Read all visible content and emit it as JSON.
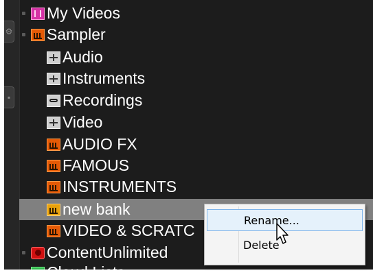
{
  "tree": {
    "items": [
      {
        "label": "My Videos",
        "icon": "video-folder-icon",
        "level": 0
      },
      {
        "label": "Sampler",
        "icon": "sampler-folder-icon",
        "level": 0
      },
      {
        "label": "Audio",
        "icon": "gray-folder-icon",
        "level": 1
      },
      {
        "label": "Instruments",
        "icon": "gray-folder-icon",
        "level": 1
      },
      {
        "label": "Recordings",
        "icon": "recordings-folder-icon",
        "level": 1
      },
      {
        "label": "Video",
        "icon": "gray-folder-icon",
        "level": 1
      },
      {
        "label": "AUDIO FX",
        "icon": "orange-bank-icon",
        "level": 1
      },
      {
        "label": "FAMOUS",
        "icon": "orange-bank-icon",
        "level": 1
      },
      {
        "label": "INSTRUMENTS",
        "icon": "orange-bank-icon",
        "level": 1
      },
      {
        "label": "new bank",
        "icon": "yellow-bank-icon",
        "level": 1,
        "selected": true
      },
      {
        "label": "VIDEO & SCRATC",
        "icon": "orange-bank-icon",
        "level": 1
      },
      {
        "label": "ContentUnlimited",
        "icon": "content-unlimited-icon",
        "level": 0
      },
      {
        "label": "Cloud Lists",
        "icon": "cloud-lists-icon",
        "level": 0
      }
    ]
  },
  "context_menu": {
    "rename_label": "Rename...",
    "delete_label": "Delete"
  },
  "colors": {
    "panel_bg": "#1c1c1c",
    "selected_row": "#808080",
    "menu_hover": "#e5f1fb"
  }
}
